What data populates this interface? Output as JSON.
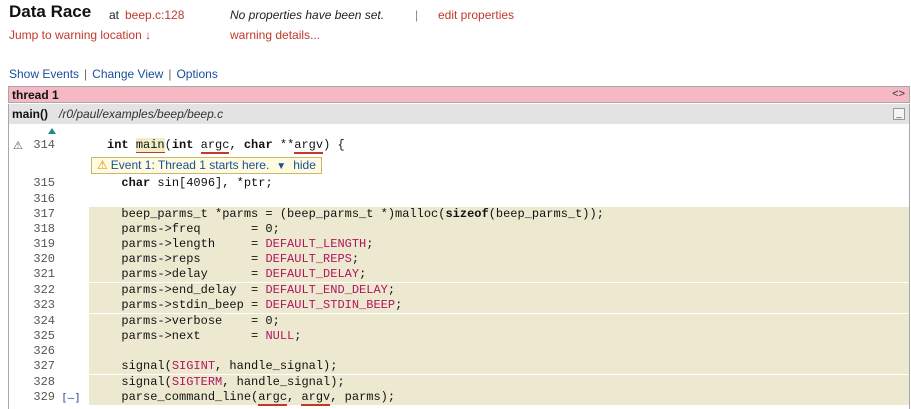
{
  "header": {
    "title": "Data Race",
    "at": "at",
    "location": "beep.c:128",
    "jump": "Jump to warning location ↓",
    "no_props": "No properties have been set.",
    "sep": "|",
    "edit": "edit properties",
    "details": "warning details..."
  },
  "links": {
    "show_events": "Show Events",
    "change_view": "Change View",
    "options": "Options",
    "sep": "|"
  },
  "thread": {
    "label": "thread 1",
    "toggle": "<>"
  },
  "func": {
    "name": "main()",
    "path": "/r0/paul/examples/beep/beep.c",
    "minimize": "_"
  },
  "event": {
    "icon": "⚠",
    "text": "Event 1:  Thread 1 starts here.",
    "dropdown": "▼",
    "hide": "hide"
  },
  "code": {
    "n314": "314",
    "n315": "315",
    "n316": "316",
    "n317": "317",
    "n318": "318",
    "n319": "319",
    "n320": "320",
    "n321": "321",
    "n322": "322",
    "n323": "323",
    "n324": "324",
    "n325": "325",
    "n326": "326",
    "n327": "327",
    "n328": "328",
    "n329": "329",
    "warn_icon": "⚠",
    "expand": "[–]"
  },
  "colors": {
    "accent_red": "#c0392b",
    "link_blue": "#1a4f99",
    "thread_bar": "#f6b9c3",
    "highlight": "#ece9d0",
    "macro": "#b0155e"
  }
}
